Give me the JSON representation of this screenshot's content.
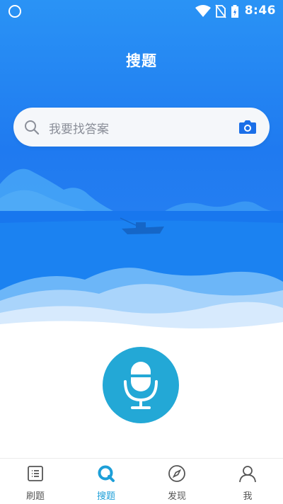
{
  "status_bar": {
    "time": "8:46"
  },
  "header": {
    "title": "搜题"
  },
  "search": {
    "placeholder": "我要找答案"
  },
  "tabs": [
    {
      "label": "刷题",
      "icon": "list-icon",
      "active": false
    },
    {
      "label": "搜题",
      "icon": "search-tab-icon",
      "active": true
    },
    {
      "label": "发现",
      "icon": "compass-icon",
      "active": false
    },
    {
      "label": "我",
      "icon": "user-icon",
      "active": false
    }
  ],
  "colors": {
    "hero_blue": "#1f7af0",
    "accent": "#1d9fd8",
    "mic_button": "#23a8d6",
    "camera": "#1b6fe8"
  }
}
